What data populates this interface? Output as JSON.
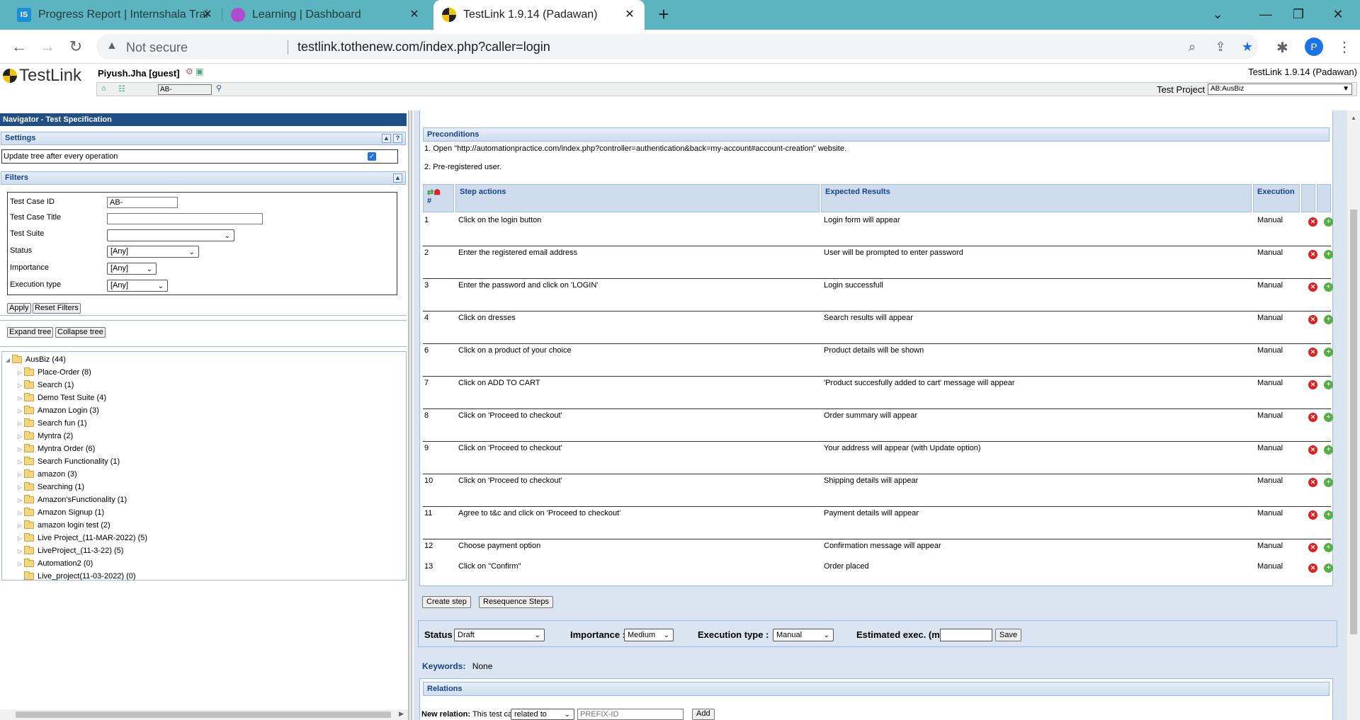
{
  "browser": {
    "tabs": [
      {
        "title": "Progress Report | Internshala Trai",
        "favicon": "IS"
      },
      {
        "title": "Learning | Dashboard",
        "favicon": "L"
      },
      {
        "title": "TestLink 1.9.14 (Padawan)",
        "favicon": "TL"
      }
    ],
    "not_secure": "Not secure",
    "url": "testlink.tothenew.com/index.php?caller=login",
    "profile_initial": "P"
  },
  "header": {
    "logo": "TestLink",
    "user": "Piyush.Jha [guest]",
    "version": "TestLink 1.9.14 (Padawan)",
    "search_value": "AB-",
    "project_label": "Test Project",
    "project_value": "AB:AusBiz"
  },
  "navigator": {
    "title": "Navigator - Test Specification",
    "settings_label": "Settings",
    "update_tree_label": "Update tree after every operation",
    "filters_label": "Filters",
    "filters": {
      "tc_id_label": "Test Case ID",
      "tc_id_value": "AB-",
      "tc_title_label": "Test Case Title",
      "tc_title_value": "",
      "suite_label": "Test Suite",
      "suite_value": "",
      "status_label": "Status",
      "status_value": "[Any]",
      "importance_label": "Importance",
      "importance_value": "[Any]",
      "exec_type_label": "Execution type",
      "exec_type_value": "[Any]"
    },
    "apply": "Apply",
    "reset": "Reset Filters",
    "expand": "Expand tree",
    "collapse": "Collapse tree",
    "tree": [
      "AusBiz (44)",
      "Place-Order (8)",
      "Search (1)",
      "Demo Test Suite (4)",
      "Amazon Login (3)",
      "Search fun (1)",
      "Myntra (2)",
      "Myntra Order (6)",
      "Search Functionality (1)",
      "amazon (3)",
      "Searching (1)",
      "Amazon'sFunctionality (1)",
      "Amazon Signup (1)",
      "amazon login test (2)",
      "Live Project_(11-MAR-2022) (5)",
      "LiveProject_(11-3-22) (5)",
      "Automation2 (0)",
      "Live_project(11-03-2022) (0)"
    ]
  },
  "testcase": {
    "preconditions_label": "Preconditions",
    "preconditions": [
      "1. Open \"http://automationpractice.com/index.php?controller=authentication&back=my-account#account-creation\" website.",
      "2. Pre-registered user."
    ],
    "columns": {
      "num": "#",
      "actions": "Step actions",
      "expected": "Expected Results",
      "execution": "Execution"
    },
    "steps": [
      {
        "n": "1",
        "action": "Click on the login button",
        "expected": "Login form will appear",
        "exec": "Manual"
      },
      {
        "n": "2",
        "action": "Enter the registered email address",
        "expected": "User will be prompted to enter password",
        "exec": "Manual"
      },
      {
        "n": "3",
        "action": "Enter the password and click on 'LOGIN'",
        "expected": "Login successfull",
        "exec": "Manual"
      },
      {
        "n": "4",
        "action": "Click on dresses",
        "expected": "Search results will appear",
        "exec": "Manual"
      },
      {
        "n": "6",
        "action": "Click on a product of your choice",
        "expected": "Product  details will be shown",
        "exec": "Manual"
      },
      {
        "n": "7",
        "action": "Click on ADD TO CART",
        "expected": " 'Product succesfully added to cart' message will appear",
        "exec": "Manual"
      },
      {
        "n": "8",
        "action": "Click on 'Proceed to checkout'",
        "expected": "Order summary will appear",
        "exec": "Manual"
      },
      {
        "n": "9",
        "action": "Click on 'Proceed to checkout'",
        "expected": "Your address will appear (with Update option)",
        "exec": "Manual"
      },
      {
        "n": "10",
        "action": "Click on 'Proceed to checkout'",
        "expected": "Shipping details will appear",
        "exec": "Manual"
      },
      {
        "n": "11",
        "action": "Agree to t&c and click on 'Proceed to checkout'",
        "expected": "Payment details will appear",
        "exec": "Manual"
      },
      {
        "n": "12",
        "action": "Choose payment option",
        "expected": "Confirmation message will appear",
        "exec": "Manual"
      },
      {
        "n": "13",
        "action": "Click on \"Confirm\"",
        "expected": "Order placed",
        "exec": "Manual"
      }
    ],
    "create_step": "Create step",
    "resequence": "Resequence Steps",
    "status_label": "Status :",
    "status_value": "Draft",
    "importance_label": "Importance :",
    "importance_value": "Medium",
    "exec_type_label": "Execution type :",
    "exec_type_value": "Manual",
    "est_label": "Estimated exec. (min) :",
    "save": "Save",
    "keywords_label": "Keywords:",
    "keywords_value": "None",
    "relations_label": "Relations",
    "new_relation_label": "New relation:",
    "this_tc": "This test case",
    "relation_value": "related to",
    "prefix_placeholder": "PREFIX-ID",
    "add": "Add"
  }
}
